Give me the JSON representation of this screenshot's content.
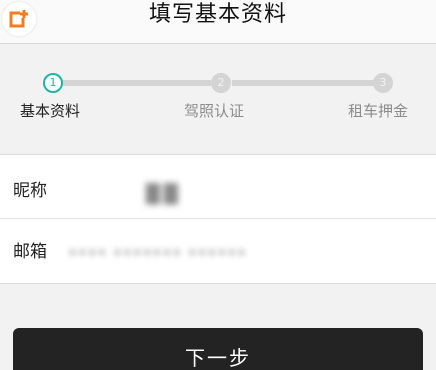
{
  "header": {
    "title": "填写基本资料",
    "logo_icon": "app-logo-icon"
  },
  "steps": [
    {
      "number": "1",
      "label": "基本资料",
      "state": "active"
    },
    {
      "number": "2",
      "label": "驾照认证",
      "state": "inactive"
    },
    {
      "number": "3",
      "label": "租车押金",
      "state": "inactive"
    }
  ],
  "form": {
    "nickname_label": "昵称",
    "nickname_value": "██",
    "email_label": "邮箱",
    "email_value": "•••• ••••••• ••••••"
  },
  "next_button_label": "下一步",
  "colors": {
    "accent": "#23b1a6",
    "logo_orange": "#f57c1f",
    "button_bg": "#232323"
  }
}
